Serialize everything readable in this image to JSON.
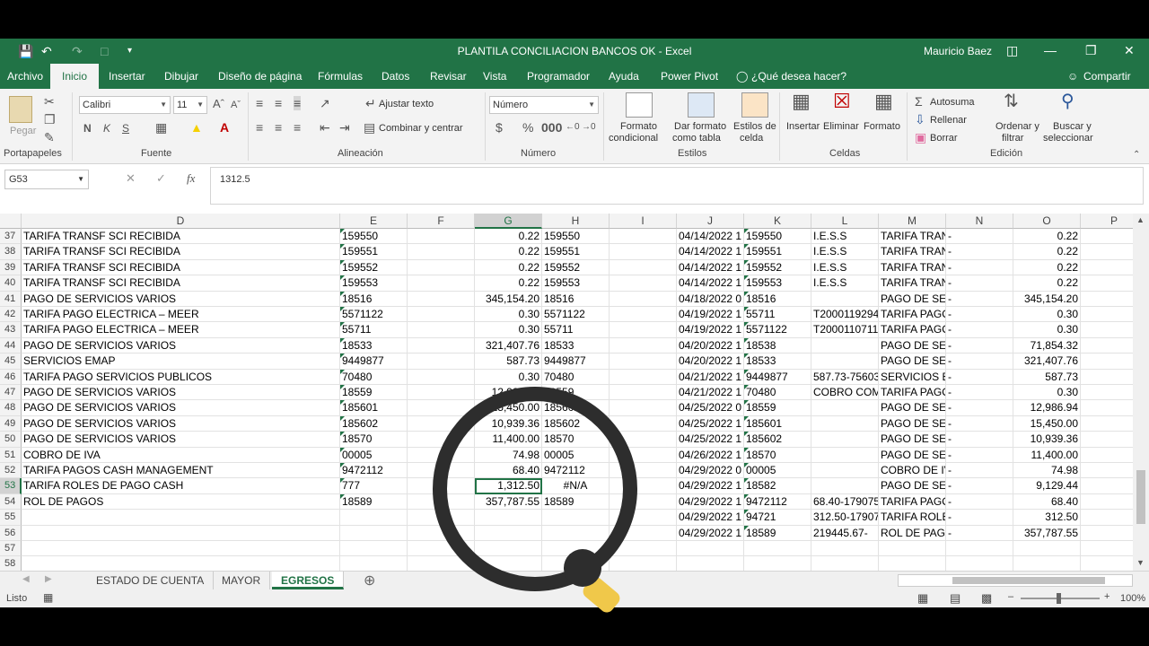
{
  "window": {
    "title": "PLANTILA CONCILIACION BANCOS OK  -  Excel",
    "user": "Mauricio Baez",
    "qat_icons": [
      "save-icon",
      "undo-icon",
      "redo-icon",
      "customize-icon",
      "qat-dropdown-icon"
    ],
    "window_buttons": [
      "ribbon-display-icon",
      "minimize-icon",
      "restore-icon",
      "close-icon"
    ]
  },
  "tabs": [
    "Archivo",
    "Inicio",
    "Insertar",
    "Dibujar",
    "Diseño de página",
    "Fórmulas",
    "Datos",
    "Revisar",
    "Vista",
    "Programador",
    "Ayuda",
    "Power Pivot"
  ],
  "tell_me": "¿Qué desea hacer?",
  "share": "Compartir",
  "ribbon": {
    "clipboard": {
      "paste": "Pegar",
      "label": "Portapapeles"
    },
    "font": {
      "name": "Calibri",
      "size": "11",
      "label": "Fuente"
    },
    "alignment": {
      "wrap": "Ajustar texto",
      "merge": "Combinar y centrar",
      "label": "Alineación"
    },
    "number": {
      "format": "Número",
      "label": "Número"
    },
    "styles": {
      "cond": "Formato",
      "cond2": "condicional",
      "table": "Dar formato",
      "table2": "como tabla",
      "cell": "Estilos de",
      "cell2": "celda",
      "label": "Estilos"
    },
    "cells": {
      "insert": "Insertar",
      "delete": "Eliminar",
      "format": "Formato",
      "label": "Celdas"
    },
    "editing": {
      "autosum": "Autosuma",
      "fill": "Rellenar",
      "clear": "Borrar",
      "sort": "Ordenar y",
      "sort2": "filtrar",
      "find": "Buscar y",
      "find2": "seleccionar",
      "label": "Edición"
    }
  },
  "formula_bar": {
    "name_box": "G53",
    "cancel": "✕",
    "enter": "✓",
    "fx": "fx",
    "value": "1312.5"
  },
  "columns": [
    "D",
    "E",
    "F",
    "G",
    "H",
    "I",
    "J",
    "K",
    "L",
    "M",
    "N",
    "O",
    "P"
  ],
  "selected_column": "G",
  "rows": [
    {
      "n": "37",
      "D": "TARIFA TRANSF SCI RECIBIDA",
      "E": "159550",
      "G": "0.22",
      "H": "159550",
      "J": "04/14/2022 1",
      "K": "159550",
      "L": "I.E.S.S",
      "M": "TARIFA TRAN",
      "N": "-",
      "O": "0.22"
    },
    {
      "n": "38",
      "D": "TARIFA TRANSF SCI RECIBIDA",
      "E": "159551",
      "G": "0.22",
      "H": "159551",
      "J": "04/14/2022 1",
      "K": "159551",
      "L": "I.E.S.S",
      "M": "TARIFA TRAN",
      "N": "-",
      "O": "0.22"
    },
    {
      "n": "39",
      "D": "TARIFA TRANSF SCI RECIBIDA",
      "E": "159552",
      "G": "0.22",
      "H": "159552",
      "J": "04/14/2022 1",
      "K": "159552",
      "L": "I.E.S.S",
      "M": "TARIFA TRAN",
      "N": "-",
      "O": "0.22"
    },
    {
      "n": "40",
      "D": "TARIFA TRANSF SCI RECIBIDA",
      "E": "159553",
      "G": "0.22",
      "H": "159553",
      "J": "04/14/2022 1",
      "K": "159553",
      "L": "I.E.S.S",
      "M": "TARIFA TRAN",
      "N": "-",
      "O": "0.22"
    },
    {
      "n": "41",
      "D": "PAGO DE SERVICIOS VARIOS",
      "E": "18516",
      "G": "345,154.20",
      "H": "18516",
      "J": "04/18/2022 0",
      "K": "18516",
      "L": "",
      "M": "PAGO DE SEF",
      "N": "-",
      "O": "345,154.20"
    },
    {
      "n": "42",
      "D": "TARIFA PAGO ELECTRICA – MEER",
      "E": "5571122",
      "G": "0.30",
      "H": "5571122",
      "J": "04/19/2022 1",
      "K": "55711",
      "L": "T2000119294",
      "M": "TARIFA PAGO",
      "N": "-",
      "O": "0.30"
    },
    {
      "n": "43",
      "D": "TARIFA PAGO ELECTRICA – MEER",
      "E": "55711",
      "G": "0.30",
      "H": "55711",
      "J": "04/19/2022 1",
      "K": "5571122",
      "L": "T2000110711",
      "M": "TARIFA PAGO",
      "N": "-",
      "O": "0.30"
    },
    {
      "n": "44",
      "D": "PAGO DE SERVICIOS VARIOS",
      "E": "18533",
      "G": "321,407.76",
      "H": "18533",
      "J": "04/20/2022 1",
      "K": "18538",
      "L": "",
      "M": "PAGO DE SEF",
      "N": "-",
      "O": "71,854.32"
    },
    {
      "n": "45",
      "D": "SERVICIOS EMAP",
      "E": "9449877",
      "G": "587.73",
      "H": "9449877",
      "J": "04/20/2022 1",
      "K": "18533",
      "L": "",
      "M": "PAGO DE SEF",
      "N": "-",
      "O": "321,407.76"
    },
    {
      "n": "46",
      "D": "TARIFA PAGO SERVICIOS PUBLICOS",
      "E": "70480",
      "G": "0.30",
      "H": "70480",
      "J": "04/21/2022 1",
      "K": "9449877",
      "L": "587.73-75603",
      "M": "SERVICIOS EI",
      "N": "-",
      "O": "587.73"
    },
    {
      "n": "47",
      "D": "PAGO DE SERVICIOS VARIOS",
      "E": "18559",
      "G": "12,986.94",
      "H": "18559",
      "J": "04/21/2022 1",
      "K": "70480",
      "L": "COBRO COM",
      "M": "TARIFA PAGO",
      "N": "-",
      "O": "0.30"
    },
    {
      "n": "48",
      "D": "PAGO DE SERVICIOS VARIOS",
      "E": "185601",
      "G": "15,450.00",
      "H": "185601",
      "J": "04/25/2022 0",
      "K": "18559",
      "L": "",
      "M": "PAGO DE SEF",
      "N": "-",
      "O": "12,986.94"
    },
    {
      "n": "49",
      "D": "PAGO DE SERVICIOS VARIOS",
      "E": "185602",
      "G": "10,939.36",
      "H": "185602",
      "J": "04/25/2022 1",
      "K": "185601",
      "L": "",
      "M": "PAGO DE SEF",
      "N": "-",
      "O": "15,450.00"
    },
    {
      "n": "50",
      "D": "PAGO DE SERVICIOS VARIOS",
      "E": "18570",
      "G": "11,400.00",
      "H": "18570",
      "J": "04/25/2022 1",
      "K": "185602",
      "L": "",
      "M": "PAGO DE SEF",
      "N": "-",
      "O": "10,939.36"
    },
    {
      "n": "51",
      "D": "COBRO DE IVA",
      "E": "00005",
      "G": "74.98",
      "H": "00005",
      "J": "04/26/2022 1",
      "K": "18570",
      "L": "",
      "M": "PAGO DE SEF",
      "N": "-",
      "O": "11,400.00"
    },
    {
      "n": "52",
      "D": "TARIFA PAGOS CASH MANAGEMENT",
      "E": "9472112",
      "G": "68.40",
      "H": "9472112",
      "J": "04/29/2022 0",
      "K": "00005",
      "L": "",
      "M": "COBRO DE IV",
      "N": "-",
      "O": "74.98"
    },
    {
      "n": "53",
      "D": "TARIFA ROLES DE PAGO CASH",
      "E": "777",
      "G": "1,312.50",
      "H": "#N/A",
      "J": "04/29/2022 1",
      "K": "18582",
      "L": "",
      "M": "PAGO DE SEF",
      "N": "-",
      "O": "9,129.44"
    },
    {
      "n": "54",
      "D": "ROL DE PAGOS",
      "E": "18589",
      "G": "357,787.55",
      "H": "18589",
      "J": "04/29/2022 1",
      "K": "9472112",
      "L": "68.40-179075",
      "M": "TARIFA PAGO",
      "N": "-",
      "O": "68.40"
    },
    {
      "n": "55",
      "D": "",
      "E": "",
      "G": "",
      "H": "",
      "J": "04/29/2022 1",
      "K": "94721",
      "L": "312.50-17907",
      "M": "TARIFA ROLE",
      "N": "-",
      "O": "312.50"
    },
    {
      "n": "56",
      "D": "",
      "E": "",
      "G": "",
      "H": "",
      "J": "04/29/2022 1",
      "K": "18589",
      "L": "219445.67-",
      "M": "ROL DE PAGO",
      "N": "-",
      "O": "357,787.55"
    },
    {
      "n": "57",
      "D": "",
      "E": "",
      "G": "",
      "H": "",
      "J": "",
      "K": "",
      "L": "",
      "M": "",
      "N": "",
      "O": ""
    },
    {
      "n": "58",
      "D": "",
      "E": "",
      "G": "",
      "H": "",
      "J": "",
      "K": "",
      "L": "",
      "M": "",
      "N": "",
      "O": ""
    }
  ],
  "sheets": [
    "ESTADO DE CUENTA",
    "MAYOR",
    "EGRESOS"
  ],
  "active_sheet": "EGRESOS",
  "status": {
    "ready": "Listo",
    "zoom": "100%"
  },
  "accent_color": "#217346"
}
